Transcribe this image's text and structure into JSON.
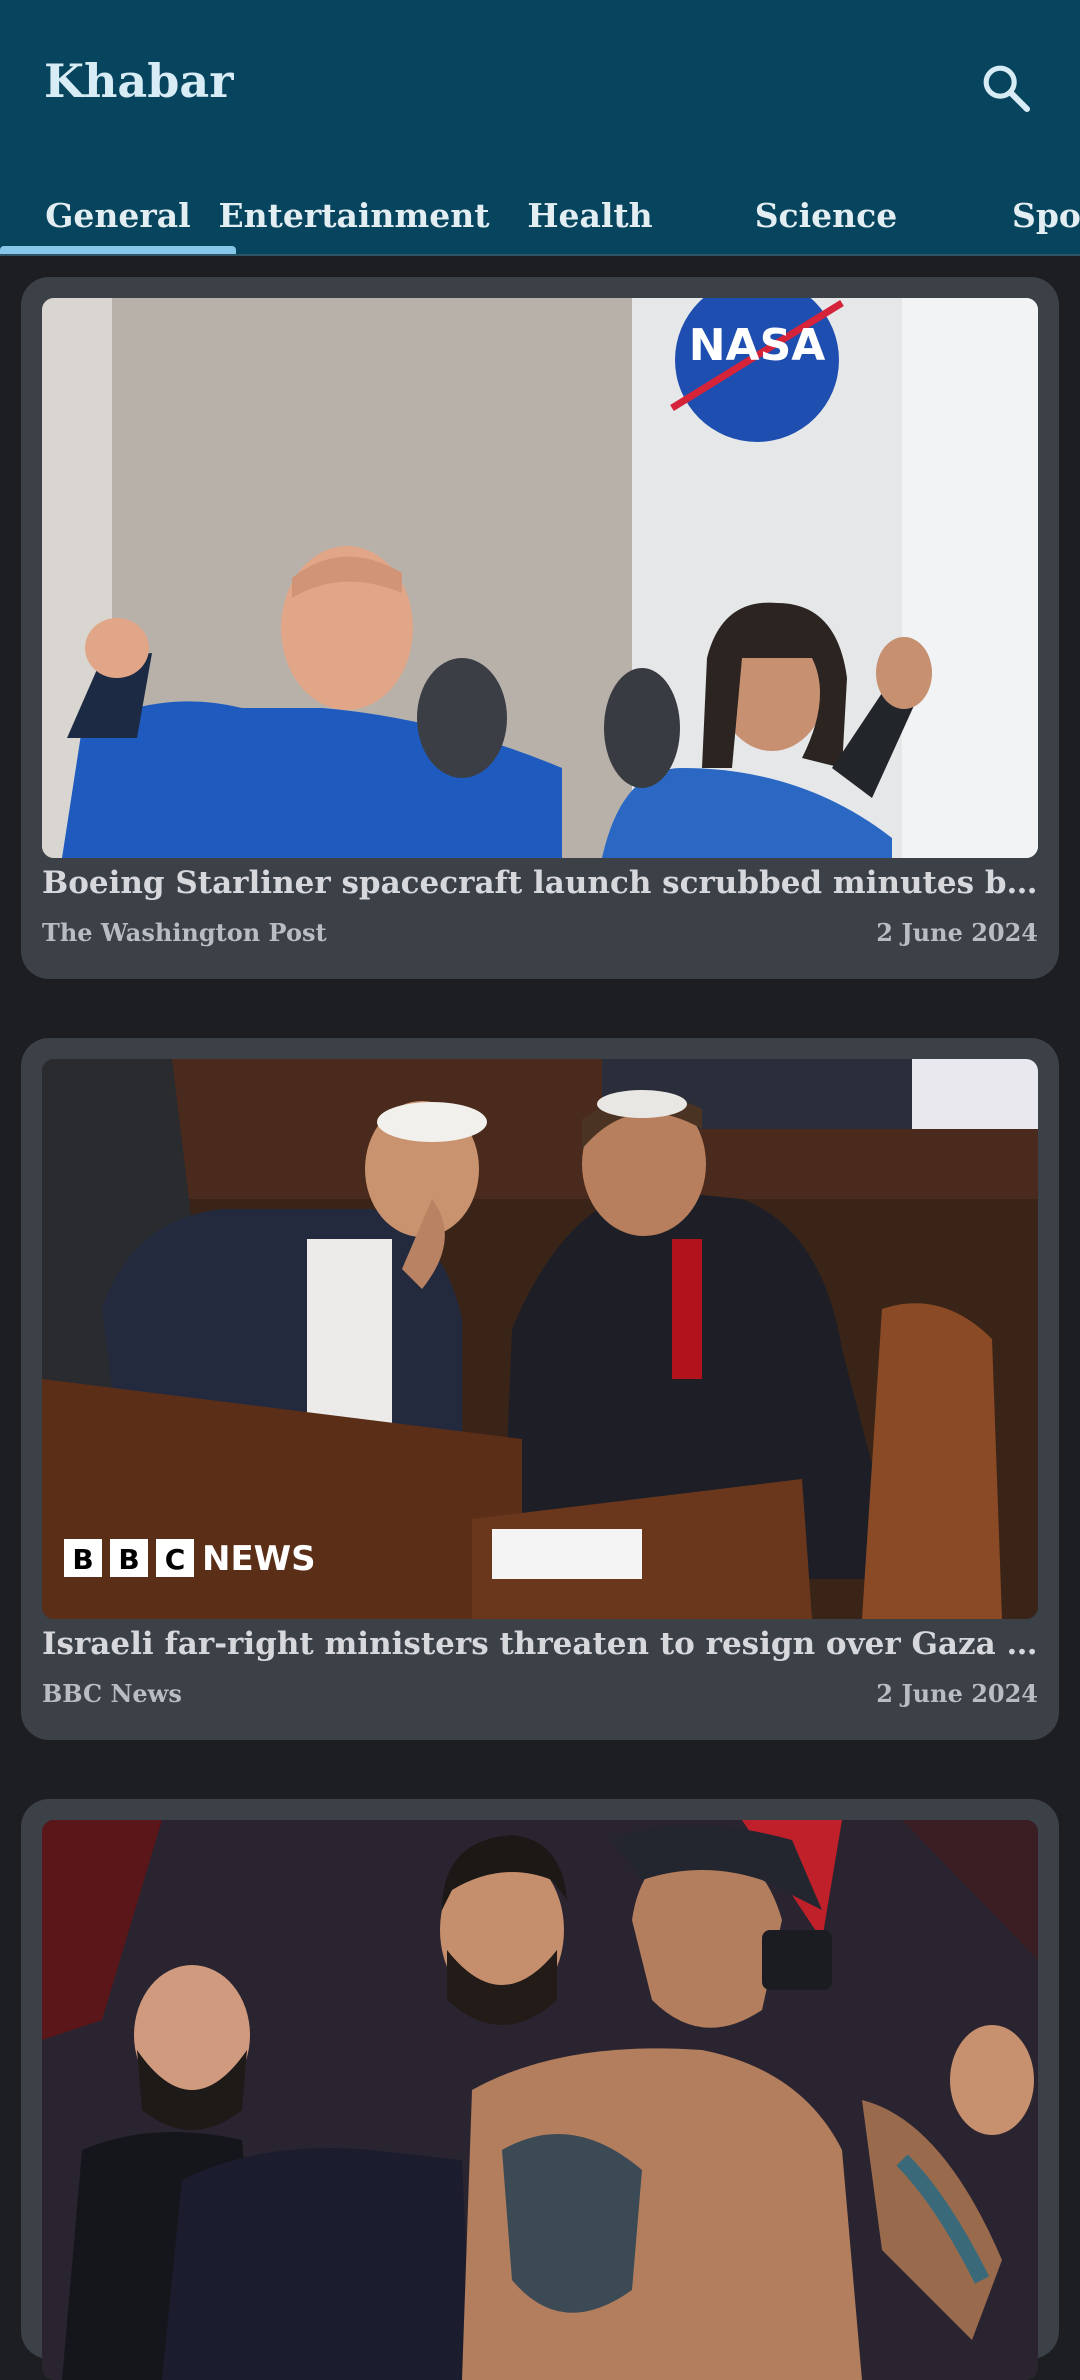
{
  "app": {
    "title": "Khabar"
  },
  "tabs": [
    "General",
    "Entertainment",
    "Health",
    "Science",
    "Sports"
  ],
  "articles": [
    {
      "headline": "Boeing Starliner spacecraft launch scrubbed minutes before liftoff after countdown hold",
      "source": "The Washington Post",
      "date": "2 June 2024",
      "image": "astronauts-photo"
    },
    {
      "headline": "Israeli far-right ministers threaten to resign over Gaza ceasefire plan",
      "source": "BBC News",
      "date": "2 June 2024",
      "image": "parliament-photo",
      "image_logo": "BBC NEWS"
    },
    {
      "image": "fighters-faceoff-photo"
    }
  ],
  "colors": {
    "appbar": "#07455f",
    "background": "#1c1e22",
    "card": "#3c4047",
    "tab_indicator": "#87c8ea"
  }
}
